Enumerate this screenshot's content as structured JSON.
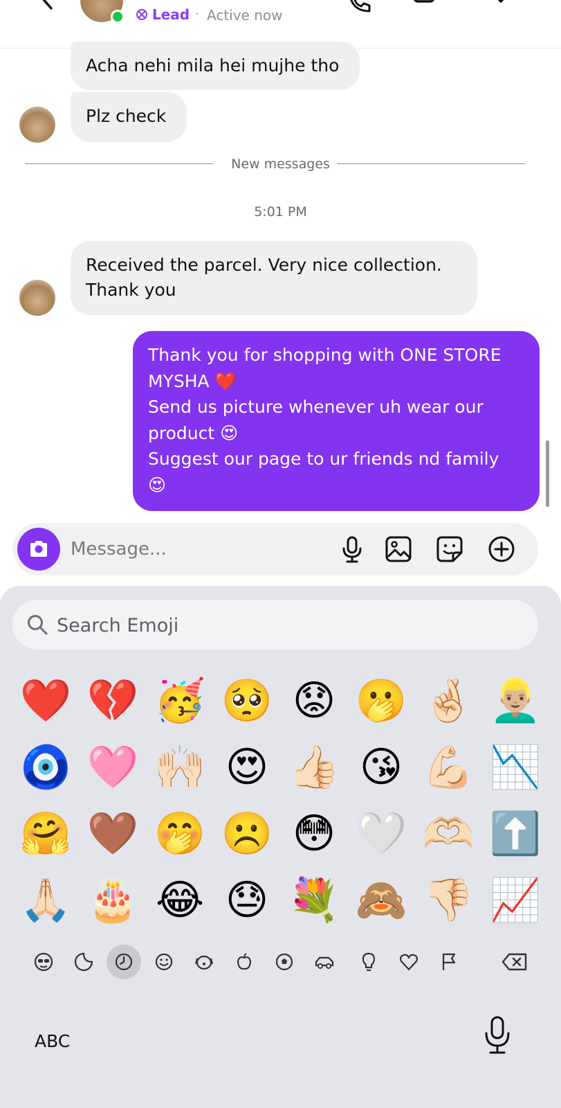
{
  "header": {
    "lead_label": "Lead",
    "separator": "·",
    "status": "Active now"
  },
  "messages": {
    "incoming_1": "Acha nehi mila hei mujhe tho",
    "incoming_2": "Plz check",
    "new_messages_label": "New messages",
    "timestamp": "5:01 PM",
    "incoming_3_line1": "Received the parcel. Very nice collection.",
    "incoming_3_line2": "Thank you",
    "outgoing_line1": "Thank you for shopping with ONE STORE",
    "outgoing_line2": "MYSHA ❤️",
    "outgoing_line3": "Send us picture whenever uh wear our",
    "outgoing_line4": "product 😍",
    "outgoing_line5": "Suggest our page to ur friends nd family",
    "outgoing_line6": "😍"
  },
  "composer": {
    "placeholder": "Message..."
  },
  "keyboard": {
    "search_placeholder": "Search Emoji",
    "emojis": [
      "❤️",
      "💔",
      "🥳",
      "🥺",
      "😟",
      "🫢",
      "🤞🏻",
      "👱🏼‍♂️",
      "🧿",
      "🩷",
      "🙌🏻",
      "😍",
      "👍🏻",
      "😘",
      "💪🏻",
      "📉",
      "🤗",
      "🤎",
      "🤭",
      "☹️",
      "😳",
      "🤍",
      "🫶🏻",
      "⬆️",
      "🙏🏻",
      "🎂",
      "😂",
      "😓",
      "💐",
      "🙈",
      "👎🏻",
      "📈"
    ],
    "categories": [
      "memoji",
      "stickers",
      "recent",
      "smileys",
      "animals",
      "food",
      "activity",
      "travel",
      "objects",
      "symbols",
      "flags"
    ],
    "active_category": "recent",
    "abc_label": "ABC"
  },
  "colors": {
    "accent": "#8433f0",
    "incoming_bubble": "#efeff1",
    "online": "#1fc44a"
  }
}
